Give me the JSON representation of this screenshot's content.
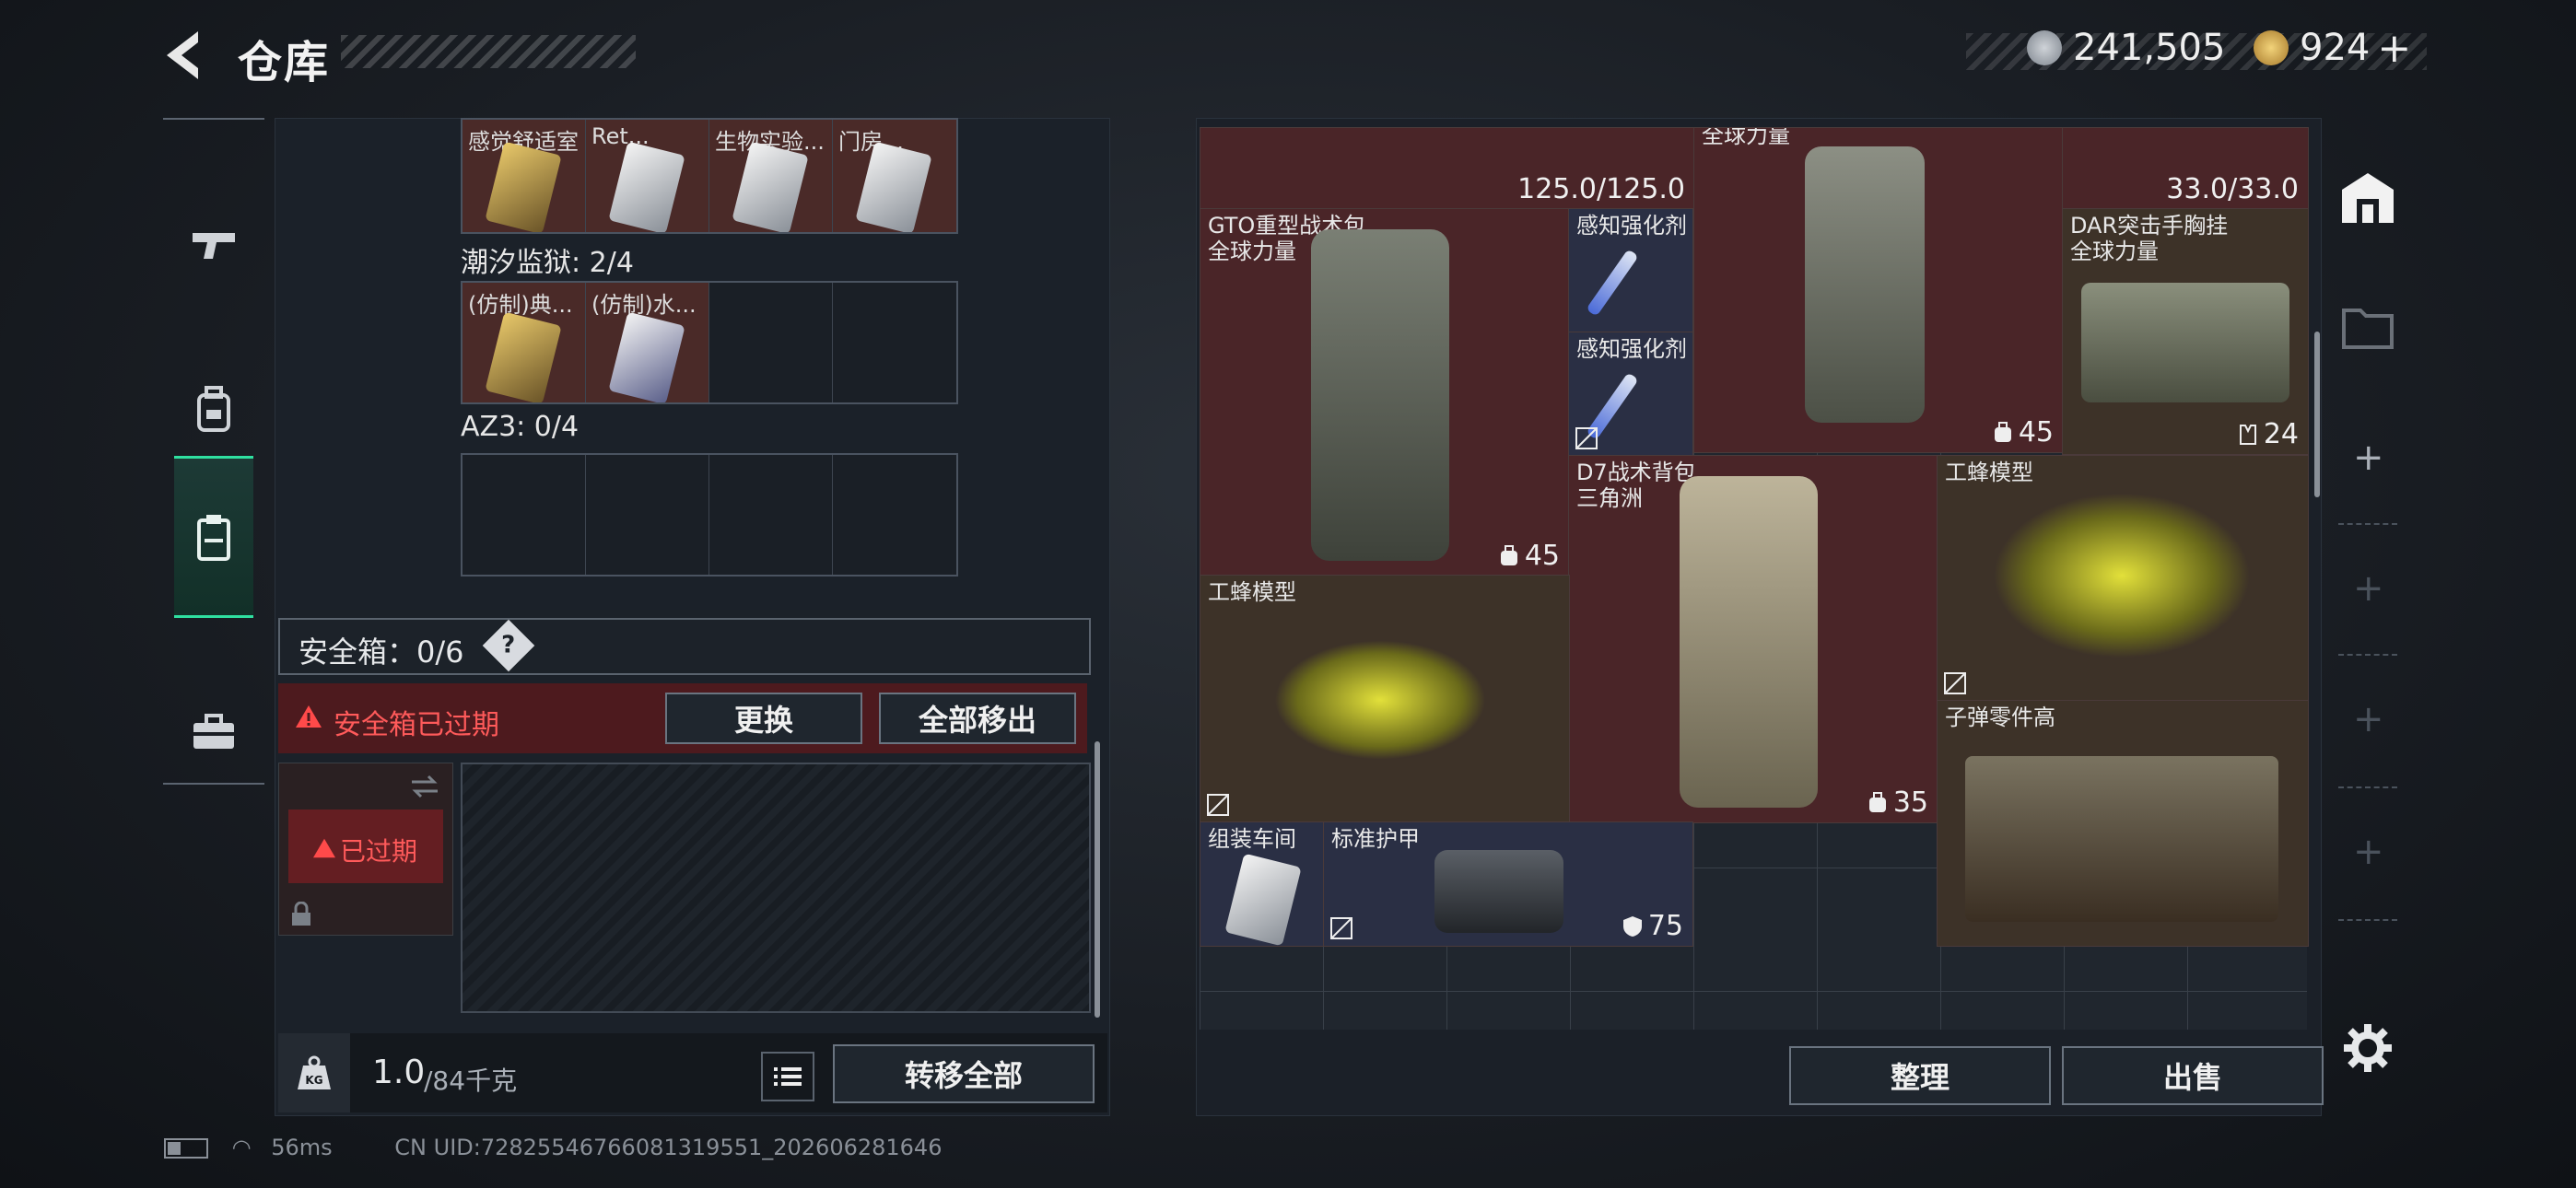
{
  "header": {
    "title": "仓库",
    "currency_silver": "241,505",
    "currency_gold": "924",
    "currency_add": "+"
  },
  "left": {
    "top_labels": [
      "感觉舒适室",
      "Ret...",
      "生物实验...",
      "门房..."
    ],
    "sections": [
      {
        "label": "潮汐监狱: 2/4",
        "slots": [
          "(仿制)典...",
          "(仿制)水..."
        ]
      },
      {
        "label": "AZ3: 0/4"
      }
    ],
    "safe_box": {
      "label": "安全箱：0/6",
      "help": "?",
      "expired_msg": "安全箱已过期",
      "replace_btn": "更换",
      "move_all_btn": "全部移出",
      "box_status": "已过期"
    },
    "weight": {
      "current": "1.0",
      "max": "/84千克",
      "transfer_btn": "转移全部"
    }
  },
  "right": {
    "items": [
      {
        "name": "",
        "value": "125.0/125.0"
      },
      {
        "name": "",
        "value": "33.0/33.0"
      },
      {
        "name": "GTO重型战术包\n全球力量",
        "value": "45"
      },
      {
        "name": "感知强化剂"
      },
      {
        "name": "感知强化剂"
      },
      {
        "name": "全球力量",
        "value": "45"
      },
      {
        "name": "DAR突击手胸挂\n全球力量",
        "value": "24"
      },
      {
        "name": "D7战术背包\n三角洲",
        "value": "35"
      },
      {
        "name": "工蜂模型"
      },
      {
        "name": "工蜂模型"
      },
      {
        "name": "子弹零件高"
      },
      {
        "name": "组装车间"
      },
      {
        "name": "标准护甲",
        "value": "75"
      }
    ],
    "sort_btn": "整理",
    "sell_btn": "出售"
  },
  "status": {
    "ping": "56ms",
    "uid": "CN UID:7282554676608131955​1_202606281646"
  },
  "colors": {
    "accent": "#2fe0a0",
    "expired": "#e03a3a",
    "item_red": "#4a2528"
  }
}
